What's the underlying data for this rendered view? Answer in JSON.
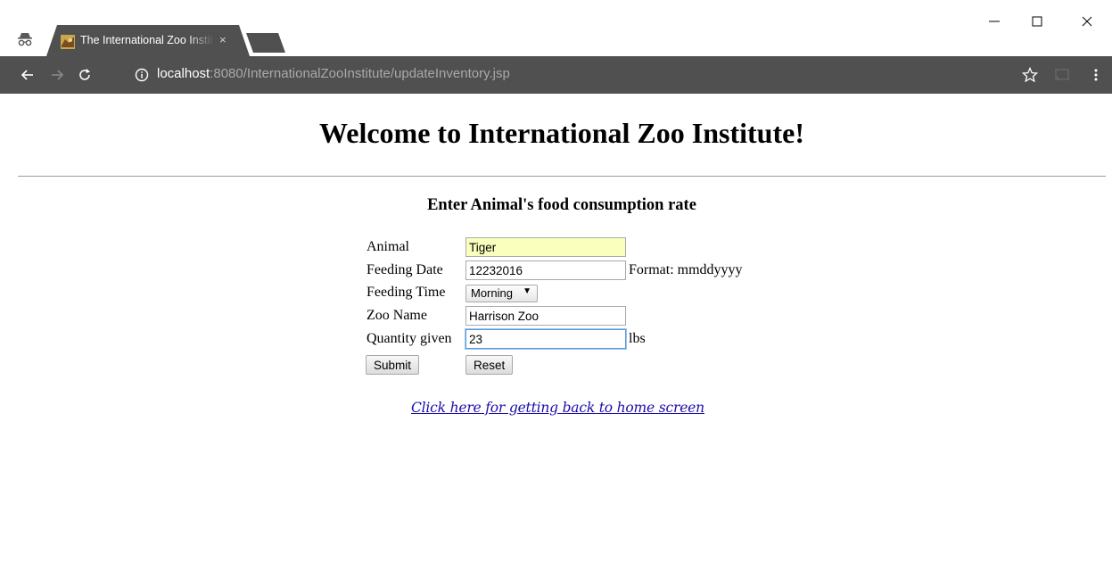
{
  "browser": {
    "tab": {
      "title": "The International Zoo Institute",
      "close_label": "×"
    },
    "address": {
      "host": "localhost",
      "path": ":8080/InternationalZooInstitute/updateInventory.jsp"
    },
    "window_controls": {
      "minimize": "—",
      "maximize": "☐",
      "close": "✕"
    },
    "colors": {
      "toolbar": "#505050",
      "tab": "#505050",
      "url_host": "#ffffff",
      "url_path": "#a9a9a9"
    }
  },
  "page": {
    "title": "Welcome to International Zoo Institute!",
    "subtitle": "Enter Animal's food consumption rate",
    "form": {
      "animal_label": "Animal",
      "animal_value": "Tiger",
      "feeding_date_label": "Feeding Date",
      "feeding_date_value": "12232016",
      "feeding_date_hint": "Format: mmddyyyy",
      "feeding_time_label": "Feeding Time",
      "feeding_time_value": "Morning",
      "zoo_name_label": "Zoo Name",
      "zoo_name_value": "Harrison Zoo",
      "quantity_label": "Quantity given",
      "quantity_value": "23",
      "quantity_unit": "lbs",
      "submit_label": "Submit",
      "reset_label": "Reset"
    },
    "home_link": "Click here for getting back to home screen",
    "colors": {
      "autofill": "#faffbd",
      "link": "#1a0dab"
    }
  }
}
